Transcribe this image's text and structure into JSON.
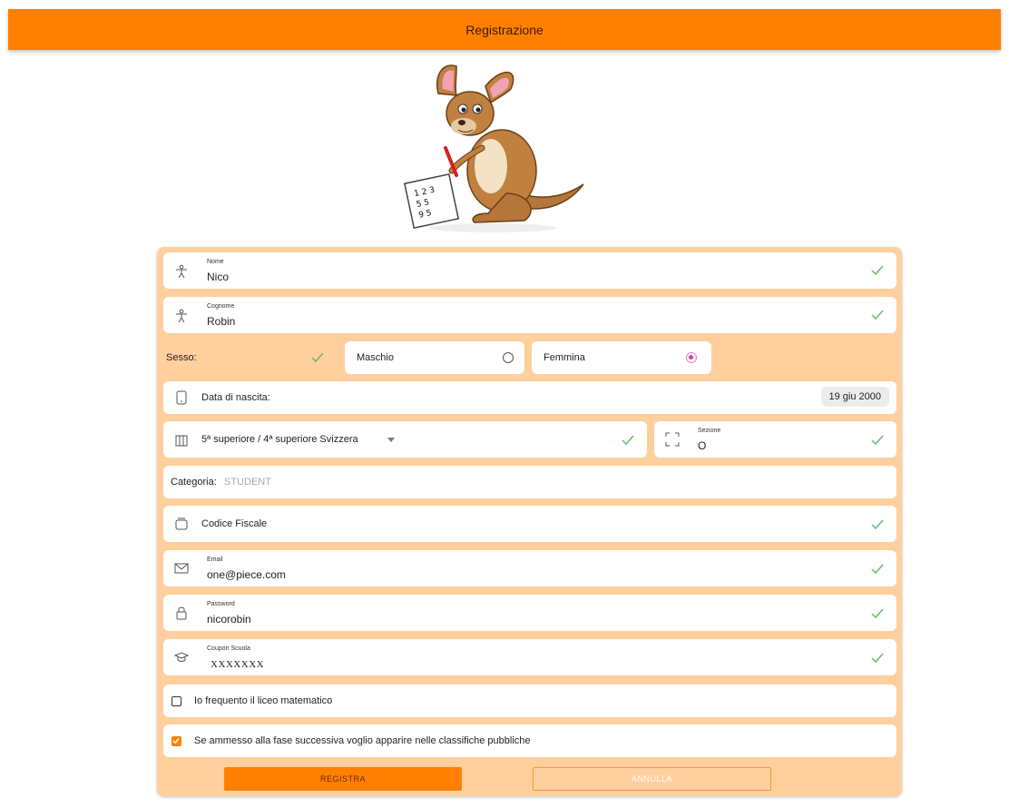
{
  "header": {
    "title": "Registrazione"
  },
  "colors": {
    "accent": "#ff8000",
    "panel": "#ffcf9e",
    "valid": "#66bb6a",
    "selected_radio": "#d6409f"
  },
  "form": {
    "nome": {
      "label": "Nome",
      "value": "Nico",
      "icon": "person-icon"
    },
    "cognome": {
      "label": "Cognome",
      "value": "Robin",
      "icon": "person-icon"
    },
    "sesso": {
      "label": "Sesso:",
      "options": [
        {
          "label": "Maschio",
          "selected": false
        },
        {
          "label": "Femmina",
          "selected": true
        }
      ]
    },
    "data_nascita": {
      "label": "Data di nascita:",
      "value": "19 giu 2000",
      "icon": "tablet-icon"
    },
    "classe": {
      "value": "5ª superiore / 4ª superiore Svizzera",
      "icon": "school-building-icon"
    },
    "sezione": {
      "label": "Sezione",
      "value": "O",
      "icon": "expand-icon"
    },
    "categoria": {
      "label": "Categoria:",
      "value": "STUDENT"
    },
    "codice_fiscale": {
      "placeholder": "Codice Fiscale",
      "icon": "id-card-icon"
    },
    "email": {
      "label": "Email",
      "value": "one@piece.com",
      "icon": "mail-icon"
    },
    "password": {
      "label": "Password",
      "value": "nicorobin",
      "icon": "lock-icon"
    },
    "coupon": {
      "label": "Coupon Scuola",
      "value": "XXXXXXX",
      "icon": "graduation-cap-icon"
    },
    "liceo_matematico": {
      "label": "Io frequento il liceo matematico",
      "checked": false
    },
    "classifiche": {
      "label": "Se ammesso alla fase successiva voglio apparire nelle classifiche pubbliche",
      "checked": true
    }
  },
  "buttons": {
    "submit": "REGISTRA",
    "cancel": "ANNULLA"
  }
}
